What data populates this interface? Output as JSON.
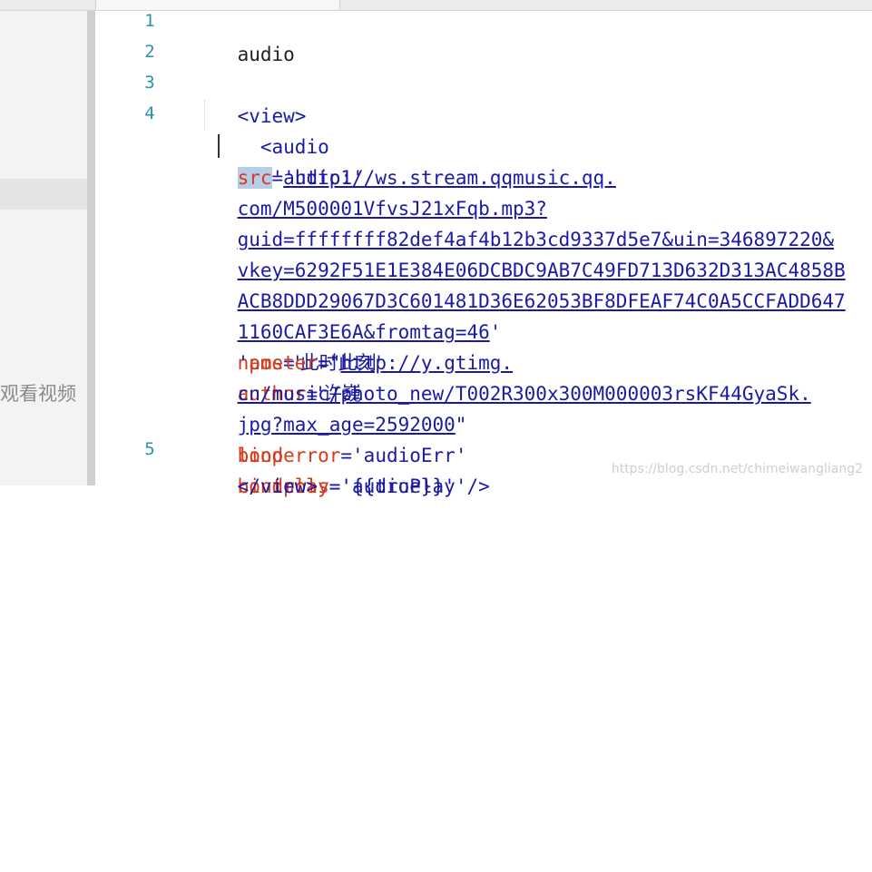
{
  "sidebar": {
    "overlay_text": "观看视频"
  },
  "editor": {
    "line_numbers": [
      "1",
      "2",
      "3",
      "4",
      "5"
    ],
    "line1": "audio",
    "line3": "<view>",
    "l4_tag_open": "<audio",
    "l4_attr_id": "id",
    "l4_eq": "=",
    "l4_val_id": "'audio1'",
    "l5_attr_src": "src",
    "l5_eq": "=",
    "l5_url": "'http://ws.stream.qqmusic.qq.",
    "l6_url": "com/M500001VfvsJ21xFqb.mp3?",
    "l7_url": "guid=ffffffff82def4af4b12b3cd9337d5e7&uin=346897220&",
    "l8_url": "vkey=6292F51E1E384E06DCBDC9AB7C49FD713D632D313AC4858B",
    "l9_url": "ACB8DDD29067D3C601481D36E62053BF8DFEAF74C0A5CCFADD647",
    "l10_url": "1160CAF3E6A&fromtag=46",
    "l10_quote": "'",
    "l10_attr_name": "name",
    "l10_eq1": "=",
    "l10_val_name": "'此时此刻'",
    "l10_attr_author": "author",
    "l10_eq2": "=",
    "l10_val_author": "'许巍",
    "l11_val": "'",
    "l11_attr_poster": "poster",
    "l11_eq": "=",
    "l11_quote": "\"",
    "l11_url": "http://y.gtimg.",
    "l12_url": "cn/music/photo_new/T002R300x300M000003rsKF44GyaSk.",
    "l13_url": "jpg?max_age=2592000",
    "l13_quote": "\"",
    "l13_attr_loop": "loop",
    "l13_attr_controls": "controls",
    "l13_eq": "=",
    "l13_val_controls": "'{{true}}'",
    "l14_attr_binderror": "binderror",
    "l14_eq1": "=",
    "l14_val_binderror": "'audioErr'",
    "l14_attr_bindplay": "bindplay",
    "l14_eq2": "=",
    "l14_val_bindplay": "'audioPlay'",
    "l14_close": "/>",
    "line5": "</view>"
  },
  "watermark": "https://blog.csdn.net/chimeiwangliang2"
}
